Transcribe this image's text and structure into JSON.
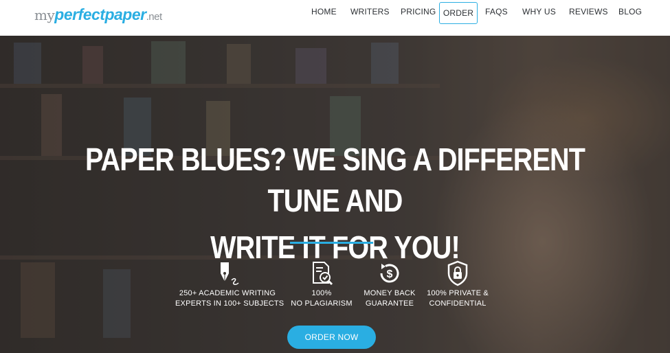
{
  "logo": {
    "part1": "my",
    "part2": "perfectpaper",
    "part3": ".net"
  },
  "nav": {
    "items": [
      {
        "label": "HOME"
      },
      {
        "label": "WRITERS"
      },
      {
        "label": "PRICING"
      },
      {
        "label": "ORDER"
      },
      {
        "label": "FAQS"
      },
      {
        "label": "WHY US"
      },
      {
        "label": "REVIEWS"
      },
      {
        "label": "BLOG"
      }
    ],
    "active": "ORDER"
  },
  "hero": {
    "headline_line1": "PAPER BLUES? WE SING A DIFFERENT TUNE AND",
    "headline_line2": "WRITE IT FOR YOU!",
    "features": [
      {
        "icon": "pen-nib-icon",
        "line1": "250+ ACADEMIC WRITING",
        "line2": "EXPERTS IN 100+ SUBJECTS"
      },
      {
        "icon": "document-check-icon",
        "line1": "100%",
        "line2": "NO PLAGIARISM"
      },
      {
        "icon": "money-back-icon",
        "line1": "MONEY BACK",
        "line2": "GUARANTEE"
      },
      {
        "icon": "shield-lock-icon",
        "line1": "100% PRIVATE &",
        "line2": "CONFIDENTIAL"
      }
    ],
    "cta_label": "ORDER NOW"
  },
  "colors": {
    "accent": "#2aaee2",
    "header_bg": "#ffffff",
    "nav_text": "#2b2f33",
    "logo_gray": "#8a8f94"
  }
}
